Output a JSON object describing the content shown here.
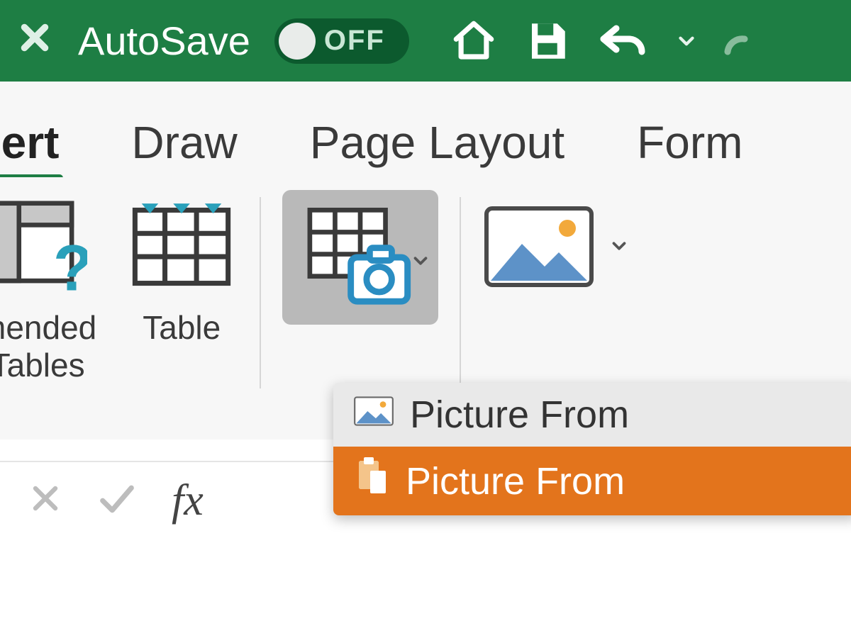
{
  "titlebar": {
    "autosave_label": "AutoSave",
    "toggle_state": "OFF"
  },
  "tabs": {
    "active": "sert",
    "items": [
      "sert",
      "Draw",
      "Page Layout",
      "Form"
    ]
  },
  "ribbon": {
    "recommended_label_line1": "mended",
    "recommended_label_line2": "Tables",
    "table_label": "Table"
  },
  "dropdown": {
    "item1": "Picture From",
    "item2": "Picture From"
  },
  "formula": {
    "fx": "fx"
  }
}
